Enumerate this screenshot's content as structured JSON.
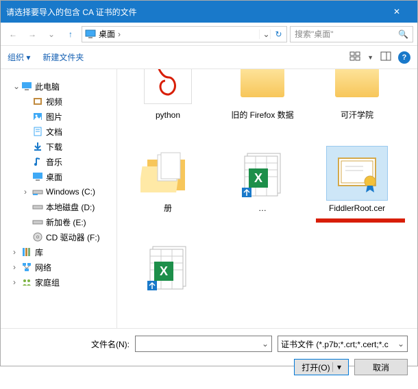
{
  "title": "请选择要导入的包含 CA 证书的文件",
  "address": {
    "location": "桌面",
    "chevron": "›"
  },
  "search": {
    "placeholder": "搜索\"桌面\""
  },
  "toolbar": {
    "organize": "组织 ▾",
    "newfolder": "新建文件夹"
  },
  "tree": {
    "thispc": "此电脑",
    "video": "视频",
    "pictures": "图片",
    "documents": "文档",
    "downloads": "下载",
    "music": "音乐",
    "desktop": "桌面",
    "winc": "Windows (C:)",
    "locald": "本地磁盘 (D:)",
    "newe": "新加卷 (E:)",
    "cdf": "CD 驱动器 (F:)",
    "libraries": "库",
    "network": "网络",
    "homegroup": "家庭组"
  },
  "files": {
    "f0": "python",
    "f1": "旧的 Firefox 数据",
    "f2": "可汗学院",
    "f3": "…",
    "f4": "册",
    "f5": "…",
    "f6": "FiddlerRoot.cer",
    "f7": ""
  },
  "footer": {
    "filename_label": "文件名(N):",
    "filter": "证书文件 (*.p7b;*.crt;*.cert;*.c",
    "open": "打开(O)",
    "cancel": "取消"
  },
  "icons": {
    "close": "✕",
    "back": "←",
    "fwd": "→",
    "up": "↑",
    "down": "⌄",
    "refresh": "↻",
    "search": "🔍"
  }
}
